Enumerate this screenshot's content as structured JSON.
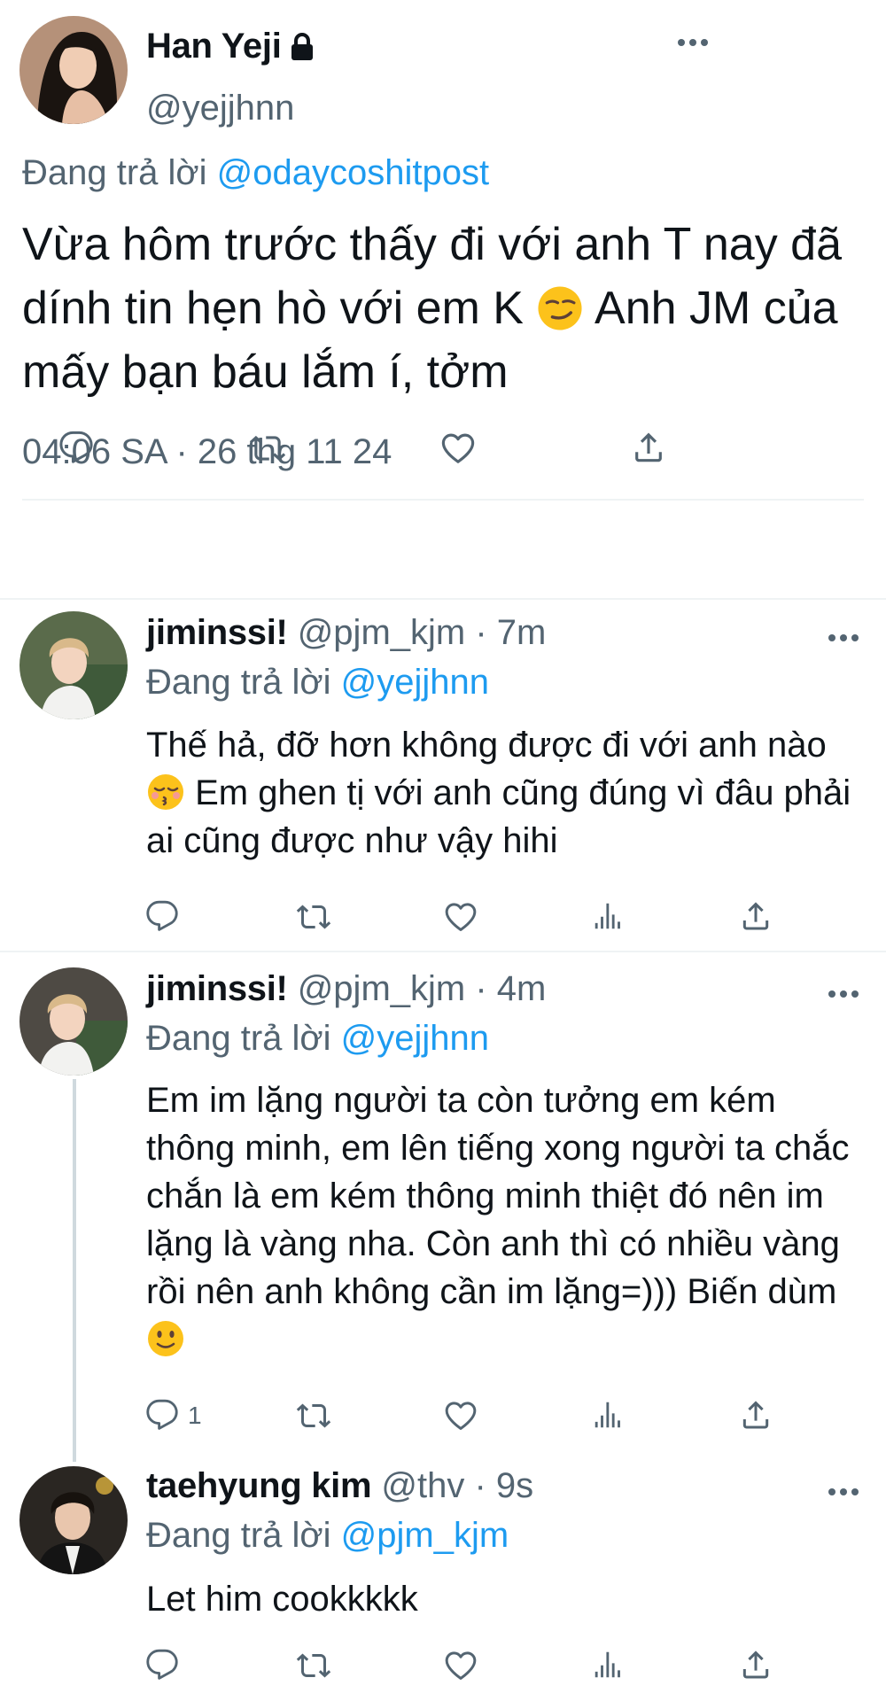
{
  "main_tweet": {
    "display_name": "Han Yeji",
    "handle": "@yejjhnn",
    "reply_prefix": "Đang trả lời",
    "reply_to": "@odaycoshitpost",
    "text_1": "Vừa hôm trước thấy đi với anh T nay đã dính tin hẹn hò với em K",
    "emoji": "😏",
    "text_2": "Anh JM của mấy bạn báu lắm í, tởm",
    "timestamp": "04:06 SA · 26 thg 11 24",
    "icons": [
      "reply-icon",
      "retweet-icon",
      "like-icon",
      "share-icon"
    ]
  },
  "replies": [
    {
      "display_name": "jiminssi!",
      "handle": "@pjm_kjm",
      "time": "· 7m",
      "reply_prefix": "Đang trả lời",
      "reply_to": "@yejjhnn",
      "text_1": "Thế hả, đỡ hơn không được đi với anh nào",
      "emoji": "😚",
      "text_2": "Em ghen tị với anh cũng đúng vì  đâu phải ai cũng được như vậy hihi",
      "reply_count": "",
      "icons": [
        "reply-icon",
        "retweet-icon",
        "like-icon",
        "analytics-icon",
        "share-icon"
      ]
    },
    {
      "display_name": "jiminssi!",
      "handle": "@pjm_kjm",
      "time": "· 4m",
      "reply_prefix": "Đang trả lời",
      "reply_to": "@yejjhnn",
      "text_1": "Em im lặng người ta còn tưởng em kém thông minh, em lên tiếng xong người ta chắc chắn là em kém thông minh thiệt đó nên im lặng là vàng nha. Còn anh thì có nhiều vàng rồi nên anh không cần im lặng=))) Biến dùm",
      "emoji": "🙂",
      "text_2": "",
      "reply_count": "1",
      "icons": [
        "reply-icon",
        "retweet-icon",
        "like-icon",
        "analytics-icon",
        "share-icon"
      ]
    },
    {
      "display_name": "taehyung kim",
      "handle": "@thv",
      "time": "· 9s",
      "reply_prefix": "Đang trả lời",
      "reply_to": "@pjm_kjm",
      "text_1": "Let him cookkkkk",
      "emoji": "",
      "text_2": "",
      "reply_count": "",
      "icons": [
        "reply-icon",
        "retweet-icon",
        "like-icon",
        "analytics-icon",
        "share-icon"
      ]
    }
  ],
  "colors": {
    "text": "#0f1419",
    "muted": "#536471",
    "link": "#1d9bf0",
    "divider": "#eff3f4"
  }
}
